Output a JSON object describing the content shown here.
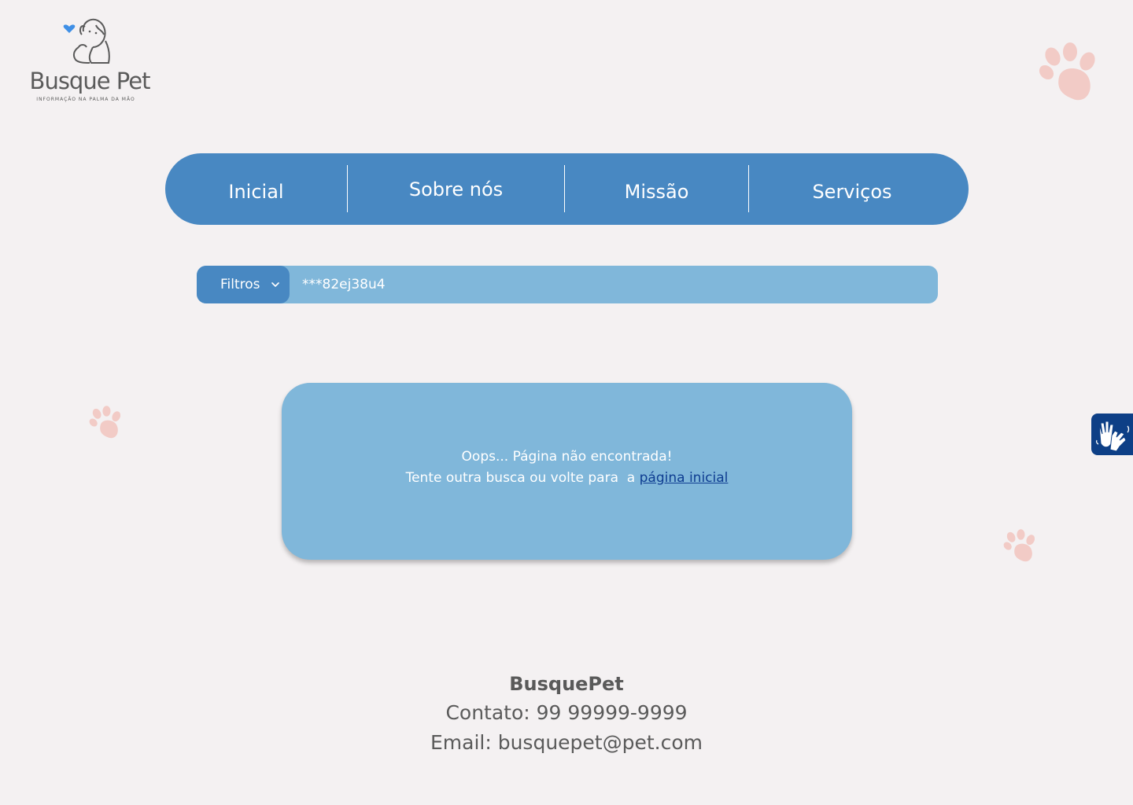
{
  "brand": {
    "logo_name": "Busque Pet",
    "tagline": "INFORMAÇÃO NA PALMA DA MÃO"
  },
  "nav": {
    "items": [
      {
        "label": "Inicial"
      },
      {
        "label": "Sobre nós"
      },
      {
        "label": "Missão"
      },
      {
        "label": "Serviços"
      }
    ]
  },
  "search": {
    "filter_label": "Filtros",
    "value": "***82ej38u4"
  },
  "error": {
    "line1": "Oops... Página não encontrada!",
    "line2_prefix": "Tente outra busca ou volte para  a ",
    "link_label": "página inicial"
  },
  "footer": {
    "brand": "BusquePet",
    "contact": "Contato: 99 99999-9999",
    "email": "Email: busquepet@pet.com"
  },
  "icons": {
    "logo": "dog-cat-heart-icon",
    "paw": "paw-icon",
    "accessibility": "sign-language-icon",
    "filter_chevron": "chevron-down-icon"
  },
  "colors": {
    "background": "#f4f1f2",
    "nav": "#4888c2",
    "search_bar": "#80b7da",
    "link": "#0e3d91",
    "paw": "#f2cbc6",
    "accessibility": "#0d3f86"
  }
}
